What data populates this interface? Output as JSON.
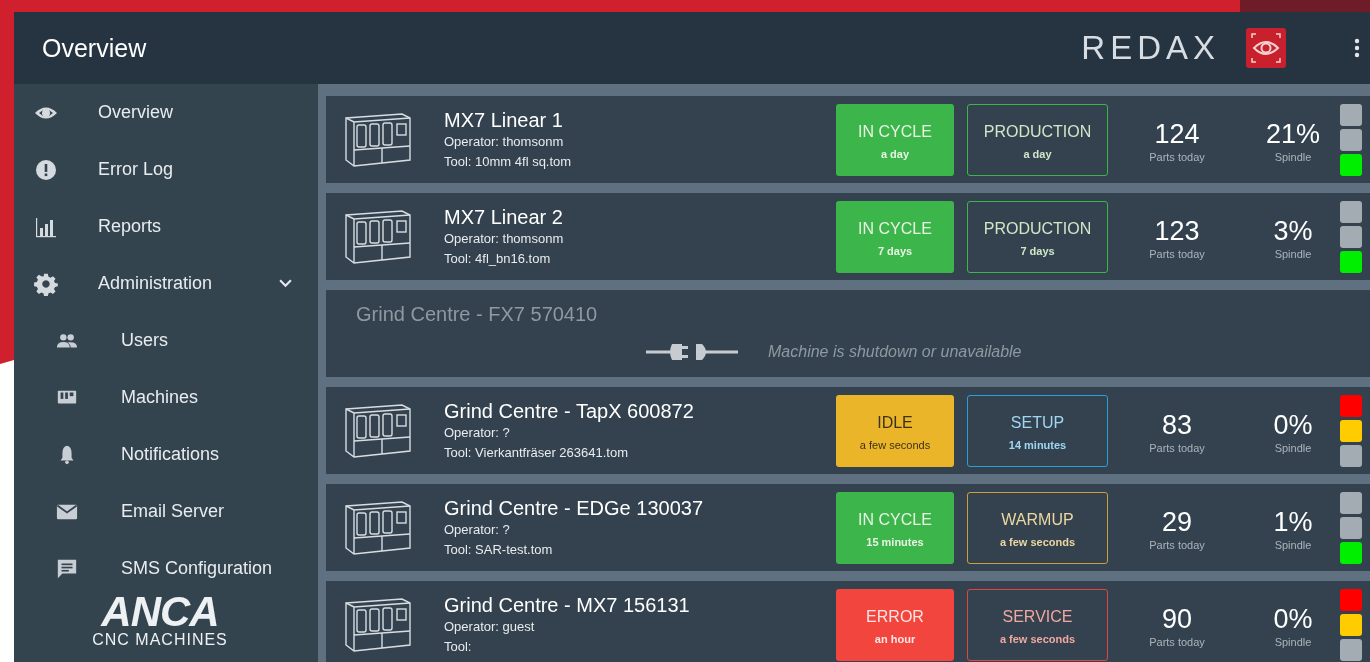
{
  "header": {
    "title": "Overview",
    "brand": "REDAX"
  },
  "sidebar": {
    "items": [
      {
        "label": "Overview"
      },
      {
        "label": "Error Log"
      },
      {
        "label": "Reports"
      },
      {
        "label": "Administration",
        "expanded": true,
        "children": [
          {
            "label": "Users"
          },
          {
            "label": "Machines"
          },
          {
            "label": "Notifications"
          },
          {
            "label": "Email Server"
          },
          {
            "label": "SMS Configuration"
          }
        ]
      }
    ],
    "logo": {
      "mark": "ANCA",
      "tagline": "CNC MACHINES"
    }
  },
  "machines": [
    {
      "kind": "online",
      "name": "MX7 Linear 1",
      "operator": "Operator: thomsonm",
      "tool": "Tool: 10mm 4fl sq.tom",
      "status": {
        "kind": "in_cycle",
        "label": "IN CYCLE",
        "time": "a day"
      },
      "mode": {
        "kind": "production",
        "label": "PRODUCTION",
        "time": "a day"
      },
      "parts": "124",
      "parts_label": "Parts today",
      "spindle": "21%",
      "spindle_label": "Spindle",
      "lights": [
        {
          "kind": "red",
          "on": false
        },
        {
          "kind": "amber",
          "on": false
        },
        {
          "kind": "green",
          "on": true
        }
      ]
    },
    {
      "kind": "online",
      "name": "MX7 Linear 2",
      "operator": "Operator: thomsonm",
      "tool": "Tool: 4fl_bn16.tom",
      "status": {
        "kind": "in_cycle",
        "label": "IN CYCLE",
        "time": "7 days"
      },
      "mode": {
        "kind": "production",
        "label": "PRODUCTION",
        "time": "7 days"
      },
      "parts": "123",
      "parts_label": "Parts today",
      "spindle": "3%",
      "spindle_label": "Spindle",
      "lights": [
        {
          "kind": "red",
          "on": false
        },
        {
          "kind": "amber",
          "on": false
        },
        {
          "kind": "green",
          "on": true
        }
      ]
    },
    {
      "kind": "offline",
      "name": "Grind Centre - FX7 570410",
      "message": "Machine is shutdown or unavailable"
    },
    {
      "kind": "online",
      "name": "Grind Centre - TapX 600872",
      "operator": "Operator: ?",
      "tool": "Tool: Vierkantfräser 263641.tom",
      "status": {
        "kind": "idle",
        "label": "IDLE",
        "time": "a few seconds"
      },
      "mode": {
        "kind": "setup",
        "label": "SETUP",
        "time": "14 minutes"
      },
      "parts": "83",
      "parts_label": "Parts today",
      "spindle": "0%",
      "spindle_label": "Spindle",
      "lights": [
        {
          "kind": "red",
          "on": true
        },
        {
          "kind": "amber",
          "on": true
        },
        {
          "kind": "green",
          "on": false
        }
      ]
    },
    {
      "kind": "online",
      "name": "Grind Centre - EDGe 130037",
      "operator": "Operator: ?",
      "tool": "Tool: SAR-test.tom",
      "status": {
        "kind": "in_cycle",
        "label": "IN CYCLE",
        "time": "15 minutes"
      },
      "mode": {
        "kind": "warmup",
        "label": "WARMUP",
        "time": "a few seconds"
      },
      "parts": "29",
      "parts_label": "Parts today",
      "spindle": "1%",
      "spindle_label": "Spindle",
      "lights": [
        {
          "kind": "red",
          "on": false
        },
        {
          "kind": "amber",
          "on": false
        },
        {
          "kind": "green",
          "on": true
        }
      ]
    },
    {
      "kind": "online",
      "name": "Grind Centre - MX7 156131",
      "operator": "Operator: guest",
      "tool": "Tool:",
      "status": {
        "kind": "error",
        "label": "ERROR",
        "time": "an hour"
      },
      "mode": {
        "kind": "service",
        "label": "SERVICE",
        "time": "a few seconds"
      },
      "parts": "90",
      "parts_label": "Parts today",
      "spindle": "0%",
      "spindle_label": "Spindle",
      "lights": [
        {
          "kind": "red",
          "on": true
        },
        {
          "kind": "amber",
          "on": true
        },
        {
          "kind": "green",
          "on": false
        }
      ]
    }
  ]
}
